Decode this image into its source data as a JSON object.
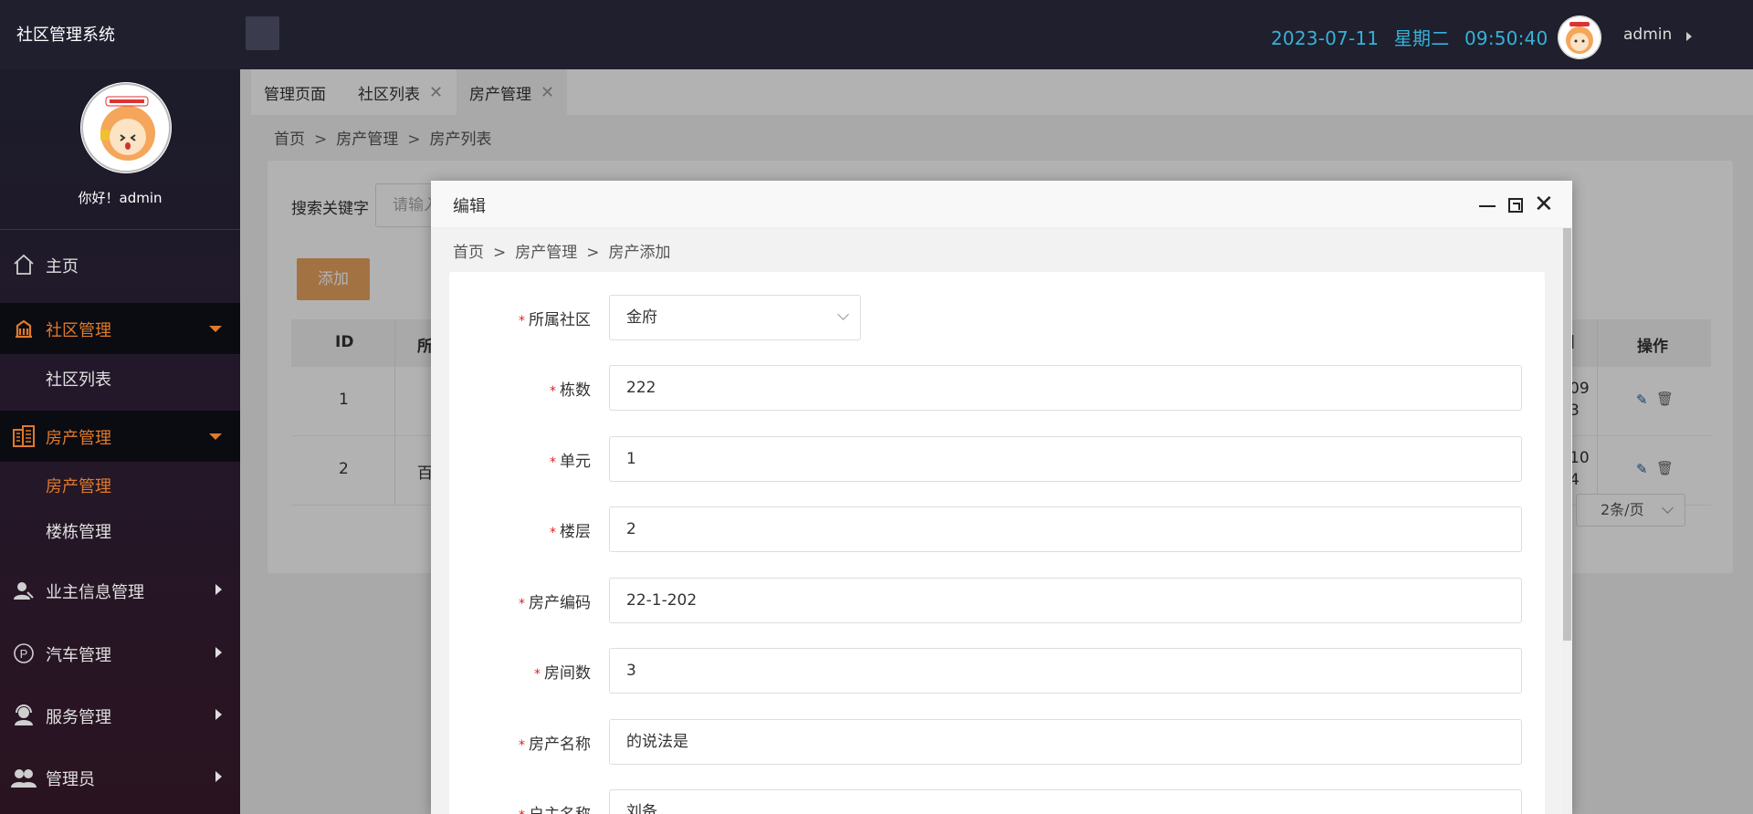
{
  "app": {
    "title": "社区管理系统",
    "date": "2023-07-11",
    "weekday": "星期二",
    "time": "09:50:40",
    "user": "admin"
  },
  "sidebar": {
    "greeting": "你好！admin",
    "items": [
      {
        "label": "主页",
        "icon": "home-icon"
      },
      {
        "label": "社区管理",
        "icon": "building-icon"
      },
      {
        "label": "社区列表"
      },
      {
        "label": "房产管理",
        "icon": "apartment-icon"
      },
      {
        "label": "房产管理"
      },
      {
        "label": "楼栋管理"
      },
      {
        "label": "业主信息管理",
        "icon": "user-icon"
      },
      {
        "label": "汽车管理",
        "icon": "parking-icon"
      },
      {
        "label": "服务管理",
        "icon": "service-icon"
      },
      {
        "label": "管理员",
        "icon": "users-icon"
      }
    ]
  },
  "tabs": [
    {
      "label": "管理页面"
    },
    {
      "label": "社区列表",
      "close": "✕"
    },
    {
      "label": "房产管理",
      "close": "✕"
    }
  ],
  "breadcrumb": {
    "home": "首页",
    "sep": ">",
    "section": "房产管理",
    "page": "房产列表"
  },
  "search": {
    "label": "搜索关键字",
    "placeholder": "请输入"
  },
  "add_button": "添加",
  "table": {
    "headers": {
      "id": "ID",
      "col2": "所",
      "time": "]",
      "ops": "操作"
    },
    "rows": [
      {
        "id": "1",
        "col2": "",
        "time_a": "09",
        "time_b": "3"
      },
      {
        "id": "2",
        "col2": "百",
        "time_a": "10",
        "time_b": "4"
      }
    ]
  },
  "pager": {
    "page_size": "2条/页"
  },
  "modal": {
    "title": "编辑",
    "close": "✕",
    "breadcrumb": {
      "home": "首页",
      "sep": ">",
      "section": "房产管理",
      "page": "房产添加"
    },
    "fields": [
      {
        "label": "所属社区",
        "value": "金府",
        "type": "select"
      },
      {
        "label": "栋数",
        "value": "222"
      },
      {
        "label": "单元",
        "value": "1"
      },
      {
        "label": "楼层",
        "value": "2"
      },
      {
        "label": "房产编码",
        "value": "22-1-202"
      },
      {
        "label": "房间数",
        "value": "3"
      },
      {
        "label": "房产名称",
        "value": "的说法是"
      },
      {
        "label": "户主名称",
        "value": "刘备"
      }
    ]
  },
  "colors": {
    "accent": "#e07a2a",
    "topbar": "#1f1f2e",
    "datetime": "#35b2d8",
    "add_button": "#e8a460"
  }
}
